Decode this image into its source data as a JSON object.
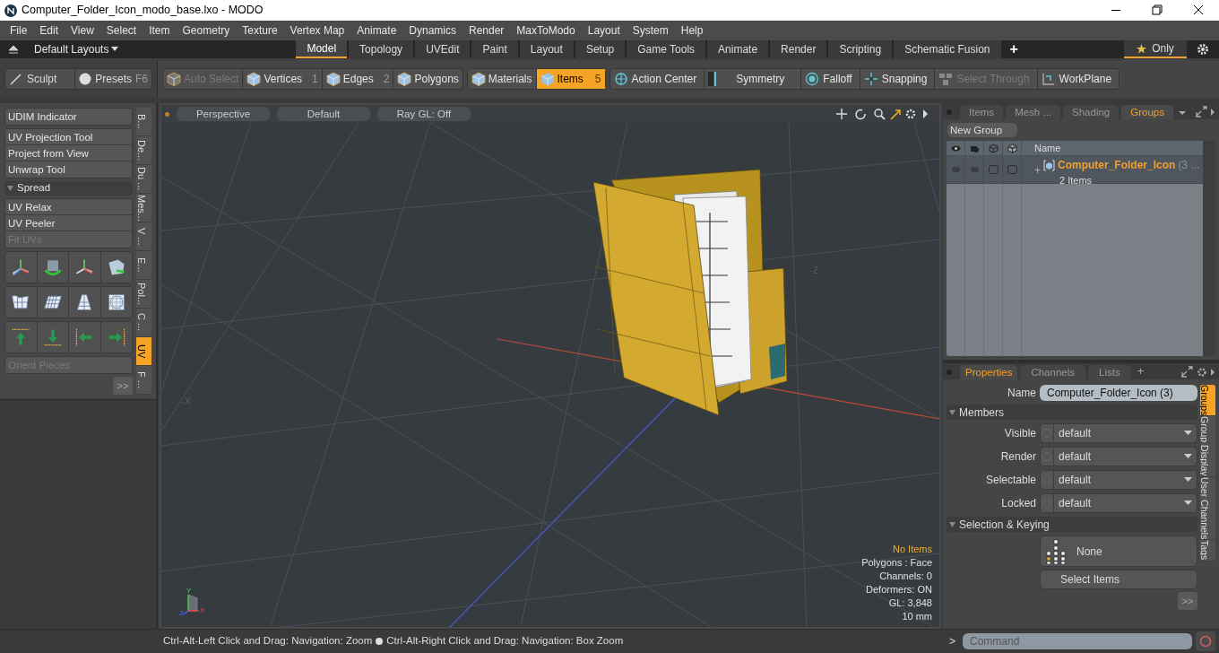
{
  "window": {
    "title": "Computer_Folder_Icon_modo_base.lxo - MODO"
  },
  "menu": [
    "File",
    "Edit",
    "View",
    "Select",
    "Item",
    "Geometry",
    "Texture",
    "Vertex Map",
    "Animate",
    "Dynamics",
    "Render",
    "MaxToModo",
    "Layout",
    "System",
    "Help"
  ],
  "layout_bar": {
    "preset": "Default Layouts",
    "tabs": [
      {
        "label": "Model",
        "selected": true
      },
      {
        "label": "Topology",
        "selected": false
      },
      {
        "label": "UVEdit",
        "selected": false
      },
      {
        "label": "Paint",
        "selected": false
      },
      {
        "label": "Layout",
        "selected": false
      },
      {
        "label": "Setup",
        "selected": false
      },
      {
        "label": "Game Tools",
        "selected": false
      },
      {
        "label": "Animate",
        "selected": false
      },
      {
        "label": "Render",
        "selected": false
      },
      {
        "label": "Scripting",
        "selected": false
      },
      {
        "label": "Schematic Fusion",
        "selected": false
      }
    ],
    "add": "+",
    "only": "Only"
  },
  "toolbar": {
    "left": [
      {
        "label": "Sculpt"
      },
      {
        "label": "Presets",
        "shortcut": "F6"
      }
    ],
    "modes": [
      {
        "label": "Auto Select",
        "disabled": true,
        "selected": false
      },
      {
        "label": "Vertices",
        "shortcut": "1",
        "disabled": false,
        "selected": false
      },
      {
        "label": "Edges",
        "shortcut": "2",
        "disabled": false,
        "selected": false
      },
      {
        "label": "Polygons",
        "disabled": false,
        "selected": false
      }
    ],
    "items": [
      {
        "label": "Materials",
        "selected": false
      },
      {
        "label": "Items",
        "shortcut": "5",
        "selected": true
      }
    ],
    "tools": [
      {
        "label": "Action Center",
        "disabled": false
      },
      {
        "label": "Symmetry",
        "disabled": false
      },
      {
        "label": "Falloff",
        "disabled": false
      },
      {
        "label": "Snapping",
        "disabled": false
      },
      {
        "label": "Select Through",
        "disabled": true
      },
      {
        "label": "WorkPlane",
        "disabled": false
      }
    ]
  },
  "left_panel": {
    "groups": [
      [
        {
          "label": "UDIM Indicator",
          "disabled": false
        }
      ],
      [
        {
          "label": "UV Projection Tool",
          "disabled": false
        },
        {
          "label": "Project from View",
          "disabled": false
        },
        {
          "label": "Unwrap Tool",
          "disabled": false
        }
      ]
    ],
    "section": "Spread",
    "section_items": [
      {
        "label": "UV Relax",
        "disabled": false
      },
      {
        "label": "UV Peeler",
        "disabled": false
      },
      {
        "label": "Fit UVs",
        "disabled": true
      }
    ],
    "orient": {
      "label": "Orient Pieces",
      "disabled": true
    },
    "more": ">>",
    "side_tabs": [
      {
        "label": "B...",
        "selected": false
      },
      {
        "label": "De...",
        "selected": false
      },
      {
        "label": "Du ...",
        "selected": false
      },
      {
        "label": "Mes...",
        "selected": false
      },
      {
        "label": "V ...",
        "selected": false
      },
      {
        "label": "E...",
        "selected": false
      },
      {
        "label": "Pol...",
        "selected": false
      },
      {
        "label": "C ...",
        "selected": false
      },
      {
        "label": "UV",
        "selected": true
      },
      {
        "label": "F ...",
        "selected": false
      }
    ]
  },
  "viewport": {
    "header": [
      "Perspective",
      "Default",
      "Ray GL: Off"
    ],
    "axis_labels": [
      "-Z",
      "-X"
    ],
    "gizmo_axes": [
      "Y",
      "Z",
      "X"
    ],
    "info": [
      {
        "text": "No Items",
        "kind": "highlight"
      },
      {
        "text": "Polygons : Face",
        "kind": "normal"
      },
      {
        "text": "Channels: 0",
        "kind": "normal"
      },
      {
        "text": "Deformers: ON",
        "kind": "normal"
      },
      {
        "text": "GL: 3,848",
        "kind": "normal"
      },
      {
        "text": "10 mm",
        "kind": "normal"
      }
    ]
  },
  "items_panel": {
    "tabs": [
      {
        "label": "Items",
        "selected": false
      },
      {
        "label": "Mesh ...",
        "selected": false
      },
      {
        "label": "Shading",
        "selected": false
      },
      {
        "label": "Groups",
        "selected": true
      }
    ],
    "new_group": "New Group",
    "name_column": "Name",
    "rows": [
      {
        "name": "Computer_Folder_Icon",
        "suffix": "(3 ...",
        "count": "2 Items",
        "expand": "+",
        "toggles": [
          {
            "on": false
          },
          {
            "on": false
          }
        ]
      }
    ]
  },
  "properties": {
    "tabs": [
      {
        "label": "Properties",
        "selected": true
      },
      {
        "label": "Channels",
        "selected": false
      },
      {
        "label": "Lists",
        "selected": false
      }
    ],
    "add": "+",
    "name_label": "Name",
    "name_value": "Computer_Folder_Icon (3)",
    "members": "Members",
    "fields": [
      {
        "label": "Visible",
        "value": "default"
      },
      {
        "label": "Render",
        "value": "default"
      },
      {
        "label": "Selectable",
        "value": "default"
      },
      {
        "label": "Locked",
        "value": "default"
      }
    ],
    "selection": "Selection & Keying",
    "none": "None",
    "select_items": "Select Items",
    "more": ">>",
    "side_tabs": [
      {
        "label": "Groups",
        "selected": true
      },
      {
        "label": "Group Display",
        "selected": false
      },
      {
        "label": "User Channels",
        "selected": false
      },
      {
        "label": "Tags",
        "selected": false
      }
    ]
  },
  "status_bar": {
    "hints": [
      "Ctrl-Alt-Left Click and Drag: Navigation: Zoom",
      "Ctrl-Alt-Right Click and Drag: Navigation: Box Zoom"
    ],
    "prompt": ">",
    "command_placeholder": "Command"
  }
}
